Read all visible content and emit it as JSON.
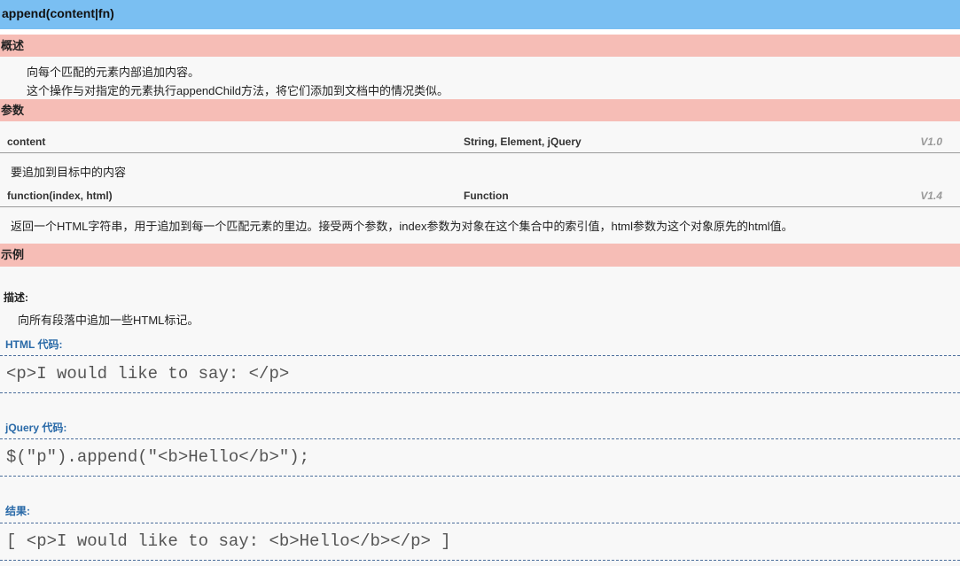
{
  "header": {
    "title": "append(content|fn)"
  },
  "overview": {
    "heading": "概述",
    "lines": [
      "向每个匹配的元素内部追加内容。",
      "这个操作与对指定的元素执行appendChild方法，将它们添加到文档中的情况类似。"
    ]
  },
  "params": {
    "heading": "参数",
    "items": [
      {
        "name": "content",
        "type": "String, Element, jQuery",
        "version": "V1.0",
        "desc": "要追加到目标中的内容"
      },
      {
        "name": "function(index, html)",
        "type": "Function",
        "version": "V1.4",
        "desc": "返回一个HTML字符串，用于追加到每一个匹配元素的里边。接受两个参数，index参数为对象在这个集合中的索引值，html参数为这个对象原先的html值。"
      }
    ]
  },
  "example": {
    "heading": "示例",
    "desc_label": "描述:",
    "desc": "向所有段落中追加一些HTML标记。",
    "html_label": "HTML 代码:",
    "html_code": "<p>I would like to say: </p>",
    "jquery_label": "jQuery 代码:",
    "jquery_code": "$(\"p\").append(\"<b>Hello</b>\");",
    "result_label": "结果:",
    "result_code": "[ <p>I would like to say: <b>Hello</b></p> ]"
  }
}
